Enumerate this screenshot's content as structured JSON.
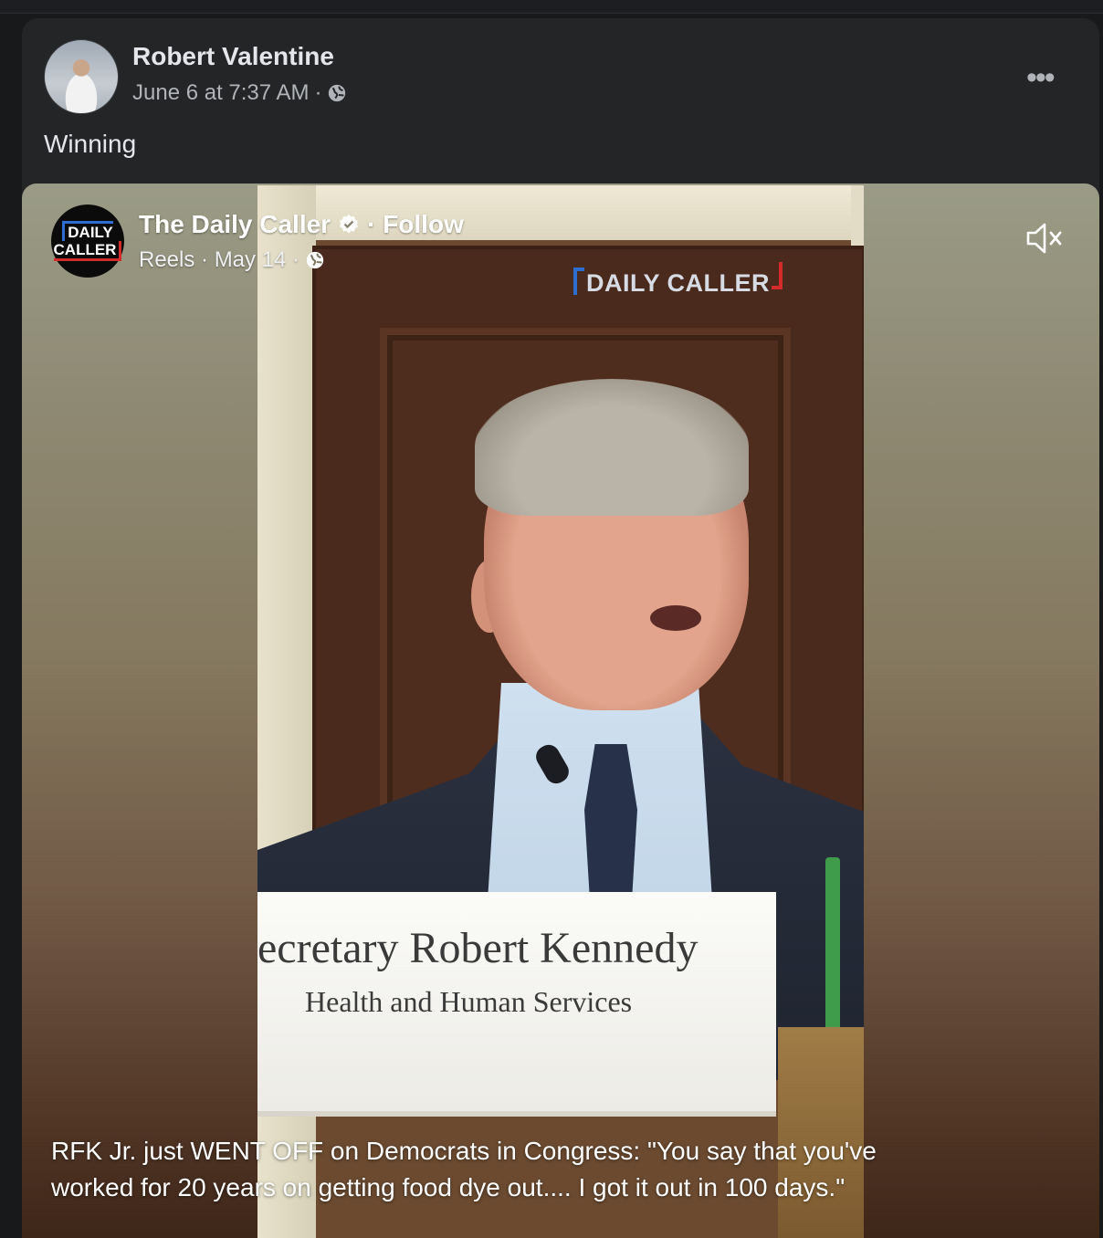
{
  "post": {
    "author": "Robert Valentine",
    "timestamp": "June 6 at 7:37 AM",
    "meta_sep": "·",
    "privacy_icon": "globe-icon",
    "more_label": "•••",
    "text": "Winning"
  },
  "reel": {
    "page_name": "The Daily Caller",
    "follow_label": "· Follow",
    "subtitle": "Reels · May 14 ·",
    "logo_line1": "DAILY",
    "logo_line2": "CALLER",
    "watermark": "DAILY CALLER",
    "mute_icon": "speaker-muted-icon",
    "nameplate_line1": "ecretary Robert Kennedy",
    "nameplate_line2": "Health and Human Services",
    "caption": "RFK Jr. just WENT OFF on Democrats in Congress: \"You say that you've worked for 20 years on getting food dye out.... I got it out in 100 days.\""
  },
  "colors": {
    "background": "#18191a",
    "card": "#242526",
    "primary_text": "#e4e6eb",
    "secondary_text": "#b0b3b8",
    "brand_blue": "#2f6ed1",
    "brand_red": "#d42a2a"
  }
}
